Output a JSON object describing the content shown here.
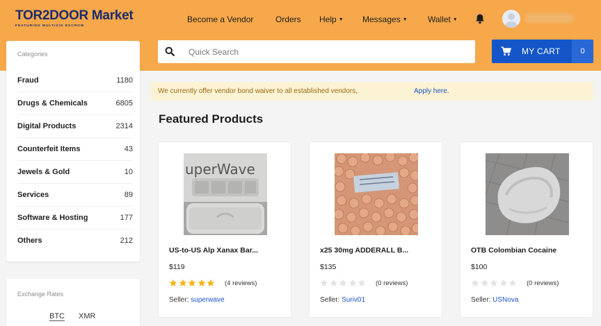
{
  "header": {
    "logo": "TOR2DOOR Market",
    "logo_tagline": "FEATURING MULTISIG ESCROW",
    "nav": {
      "become_vendor": "Become a Vendor",
      "orders": "Orders",
      "help": "Help",
      "messages": "Messages",
      "wallet": "Wallet"
    },
    "icons": {
      "notifications": "bell-icon",
      "user": "avatar-icon",
      "cart": "cart-icon",
      "search": "search-icon"
    }
  },
  "search": {
    "placeholder": "Quick Search"
  },
  "cart": {
    "label": "MY CART",
    "count": "0"
  },
  "sidebar": {
    "categories_title": "Categories",
    "categories": [
      {
        "name": "Fraud",
        "count": "1180"
      },
      {
        "name": "Drugs & Chemicals",
        "count": "6805"
      },
      {
        "name": "Digital Products",
        "count": "2314"
      },
      {
        "name": "Counterfeit Items",
        "count": "43"
      },
      {
        "name": "Jewels & Gold",
        "count": "10"
      },
      {
        "name": "Services",
        "count": "89"
      },
      {
        "name": "Software & Hosting",
        "count": "177"
      },
      {
        "name": "Others",
        "count": "212"
      }
    ],
    "exchange_title": "Exchange Rates",
    "exchange_tabs": [
      "BTC",
      "XMR"
    ]
  },
  "banner": {
    "text": "We currently offer vendor bond waiver to all established vendors,",
    "link": "Apply here."
  },
  "featured": {
    "title": "Featured Products",
    "seller_label": "Seller:",
    "products": [
      {
        "title": "US-to-US Alp Xanax Bar...",
        "price": "$119",
        "rating": 5,
        "reviews": "(4 reviews)",
        "seller": "superwave",
        "image_text": "uperWave"
      },
      {
        "title": "x25 30mg ADDERALL B...",
        "price": "$135",
        "rating": 0,
        "reviews": "(0 reviews)",
        "seller": "Suriv01",
        "image_text": ""
      },
      {
        "title": "OTB Colombian Cocaine",
        "price": "$100",
        "rating": 0,
        "reviews": "(0 reviews)",
        "seller": "USNova",
        "image_text": ""
      }
    ]
  },
  "colors": {
    "header_bg": "#f6a84a",
    "cart_bg": "#1456c8",
    "link": "#1d53c5",
    "star_filled": "#f6b419",
    "star_empty": "#e3e3e3",
    "banner_bg": "#fcf3d4"
  }
}
